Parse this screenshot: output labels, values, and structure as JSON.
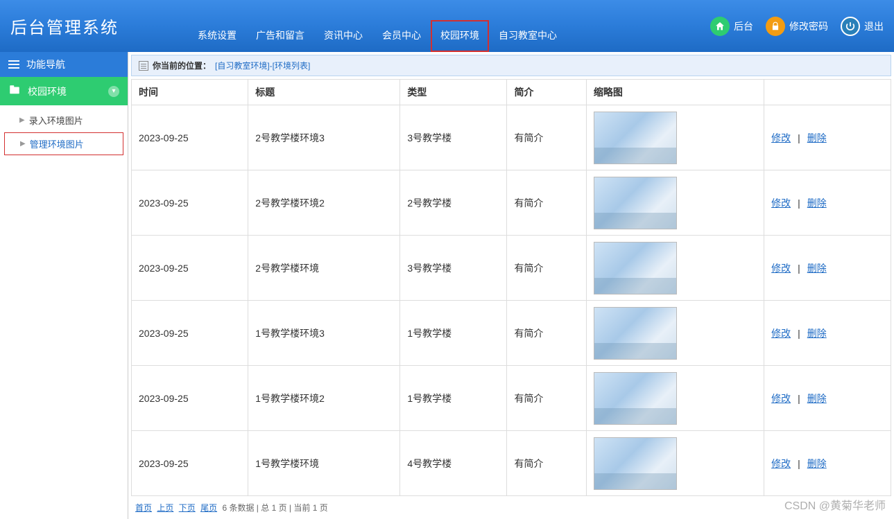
{
  "header": {
    "logo": "后台管理系统",
    "nav": [
      {
        "label": "系统设置"
      },
      {
        "label": "广告和留言"
      },
      {
        "label": "资讯中心"
      },
      {
        "label": "会员中心"
      },
      {
        "label": "校园环境",
        "highlight": true
      },
      {
        "label": "自习教室中心"
      }
    ],
    "right": {
      "home": "后台",
      "password": "修改密码",
      "logout": "退出"
    }
  },
  "sidebar": {
    "title": "功能导航",
    "section": "校园环境",
    "items": [
      {
        "label": "录入环境图片"
      },
      {
        "label": "管理环境图片",
        "active": true
      }
    ]
  },
  "breadcrumb": {
    "label": "你当前的位置：",
    "path": "[自习教室环境]-[环境列表]"
  },
  "table": {
    "headers": [
      "时间",
      "标题",
      "类型",
      "简介",
      "缩略图",
      ""
    ],
    "rows": [
      {
        "date": "2023-09-25",
        "title": "2号教学楼环境3",
        "type": "3号教学楼",
        "intro": "有简介"
      },
      {
        "date": "2023-09-25",
        "title": "2号教学楼环境2",
        "type": "2号教学楼",
        "intro": "有简介"
      },
      {
        "date": "2023-09-25",
        "title": "2号教学楼环境",
        "type": "3号教学楼",
        "intro": "有简介"
      },
      {
        "date": "2023-09-25",
        "title": "1号教学楼环境3",
        "type": "1号教学楼",
        "intro": "有简介"
      },
      {
        "date": "2023-09-25",
        "title": "1号教学楼环境2",
        "type": "1号教学楼",
        "intro": "有简介"
      },
      {
        "date": "2023-09-25",
        "title": "1号教学楼环境",
        "type": "4号教学楼",
        "intro": "有简介"
      }
    ],
    "actions": {
      "edit": "修改",
      "delete": "删除"
    }
  },
  "pager": {
    "first": "首页",
    "prev": "上页",
    "next": "下页",
    "last": "尾页",
    "info": "6 条数据 | 总 1 页 | 当前 1 页"
  },
  "watermark": "CSDN @黄菊华老师"
}
